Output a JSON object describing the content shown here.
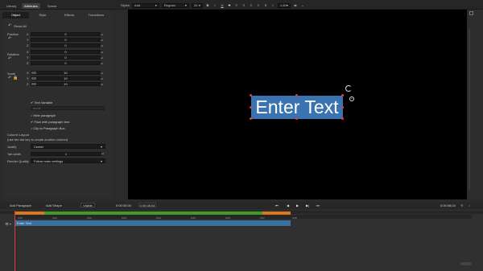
{
  "panel_tabs": [
    "Library",
    "Attributes",
    "Scene"
  ],
  "active_panel_tab": "Attributes",
  "format_bar": {
    "styles_label": "Styles",
    "style_value": "Add",
    "weight_value": "Regular",
    "size_value": "20",
    "bold": "B",
    "italic": "I",
    "underline": "U",
    "strike": "S",
    "line_spacing_value": "1.50"
  },
  "subtabs": [
    "Object",
    "Style",
    "Effects",
    "Transitions"
  ],
  "reset_all": "Reset All",
  "groups": {
    "position": "Position",
    "rotation": "Rotation",
    "scale": "Scale"
  },
  "position_rows": [
    {
      "axis": "X",
      "value": "0"
    },
    {
      "axis": "Y",
      "value": "0"
    },
    {
      "axis": "Z",
      "value": "0"
    }
  ],
  "rotation_rows": [
    {
      "axis": "X",
      "value": "0"
    },
    {
      "axis": "Y",
      "value": "0"
    },
    {
      "axis": "Z",
      "value": "0"
    }
  ],
  "scale_rows": [
    {
      "axis": "X",
      "value": "10"
    },
    {
      "axis": "Y",
      "value": "10"
    },
    {
      "axis": "Z",
      "value": "10"
    }
  ],
  "options": {
    "text_variable": "Text Variable",
    "text_field": "Text 01",
    "hide_paragraph": "Hide paragraph",
    "flow_with_paragraph": "Flow with paragraph text",
    "clip_to_bounds": "Clip to Paragraph Box"
  },
  "column_layout": {
    "title": "Column Layout",
    "hint": "(use the tab key to create another column)",
    "justify_label": "Justify",
    "justify_value": "Center",
    "tab_width_label": "Tab width",
    "tab_width_value": "1",
    "render_quality_label": "Render Quality",
    "render_quality_value": "Follow main settings"
  },
  "canvas": {
    "text": "Enter Text"
  },
  "add_bar": {
    "add_paragraph": "Add Paragraph",
    "add_shape": "Add Shape",
    "mode": "Visible",
    "timecode_left": "0:00:00;00",
    "timecode_field": "0:00:08;04",
    "timecode_right": "0:00:08;04"
  },
  "timeline": {
    "ticks": [
      "0:00",
      "0:01",
      "0:02",
      "0:03",
      "0:04",
      "0:05",
      "0:06",
      "0:07",
      "0:08"
    ],
    "track_label": "Enter Text"
  },
  "colors": {
    "accent_blue": "#3a73b0",
    "handle_red": "#e23b3b",
    "ruler_green": "#3e9b2c",
    "ruler_orange": "#d9771e"
  }
}
